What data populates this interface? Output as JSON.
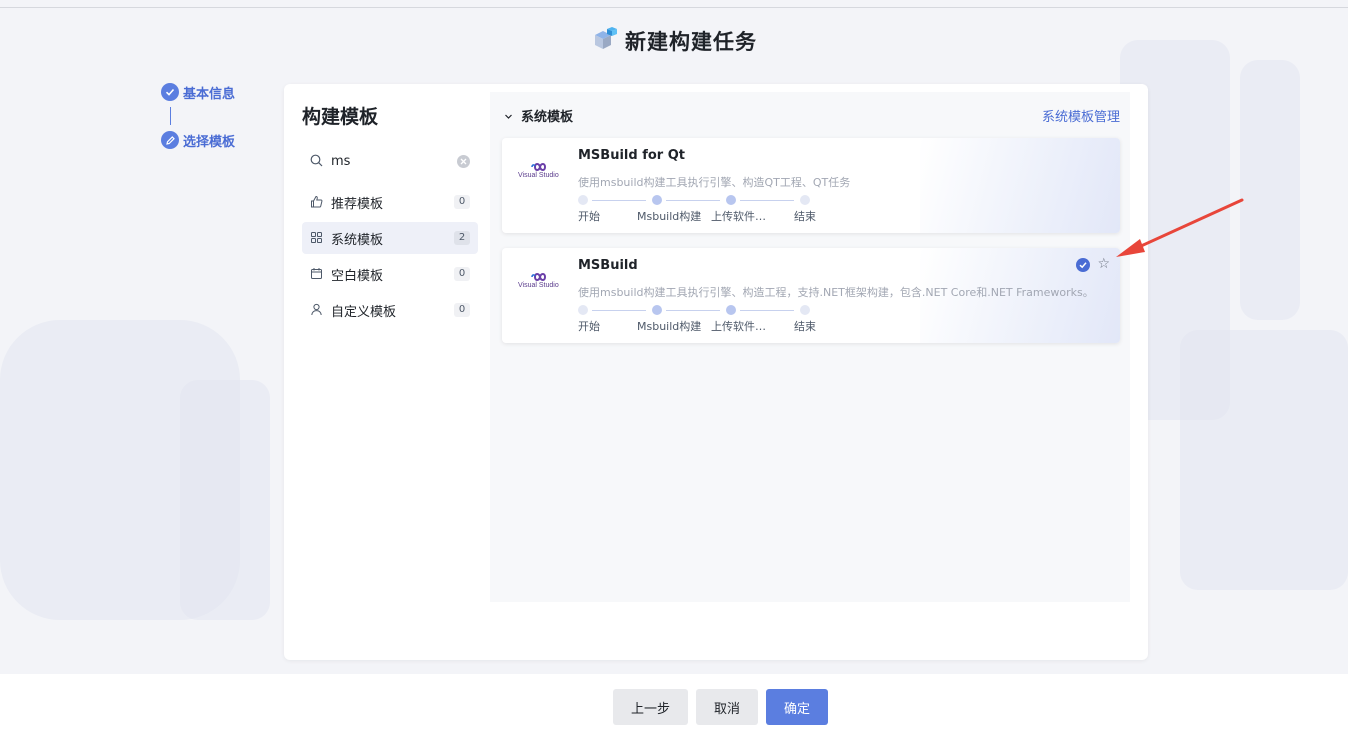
{
  "header": {
    "title": "新建构建任务",
    "icon": "cube-icon"
  },
  "steps": [
    {
      "label": "基本信息",
      "icon": "check-icon"
    },
    {
      "label": "选择模板",
      "icon": "edit-icon"
    }
  ],
  "left": {
    "heading": "构建模板",
    "search": {
      "value": "ms",
      "icon": "search-icon"
    },
    "categories": [
      {
        "label": "推荐模板",
        "count": "0",
        "icon": "thumb-up-icon"
      },
      {
        "label": "系统模板",
        "count": "2",
        "icon": "grid-icon"
      },
      {
        "label": "空白模板",
        "count": "0",
        "icon": "calendar-icon"
      },
      {
        "label": "自定义模板",
        "count": "0",
        "icon": "user-icon"
      }
    ]
  },
  "right": {
    "section_label": "系统模板",
    "manage_link": "系统模板管理",
    "templates": [
      {
        "name": "MSBuild for Qt",
        "logo_text": "Visual Studio",
        "desc": "使用msbuild构建工具执行引擎、构造QT工程、QT任务",
        "stages": [
          "开始",
          "Msbuild构建",
          "上传软件…",
          "结束"
        ]
      },
      {
        "name": "MSBuild",
        "logo_text": "Visual Studio",
        "desc": "使用msbuild构建工具执行引擎、构造工程，支持.NET框架构建，包含.NET Core和.NET Frameworks。",
        "stages": [
          "开始",
          "Msbuild构建",
          "上传软件…",
          "结束"
        ]
      }
    ]
  },
  "footer": {
    "prev_label": "上一步",
    "cancel_label": "取消",
    "confirm_label": "确定"
  },
  "colors": {
    "accent": "#5b7ee0",
    "annotation": "#e8463a"
  }
}
